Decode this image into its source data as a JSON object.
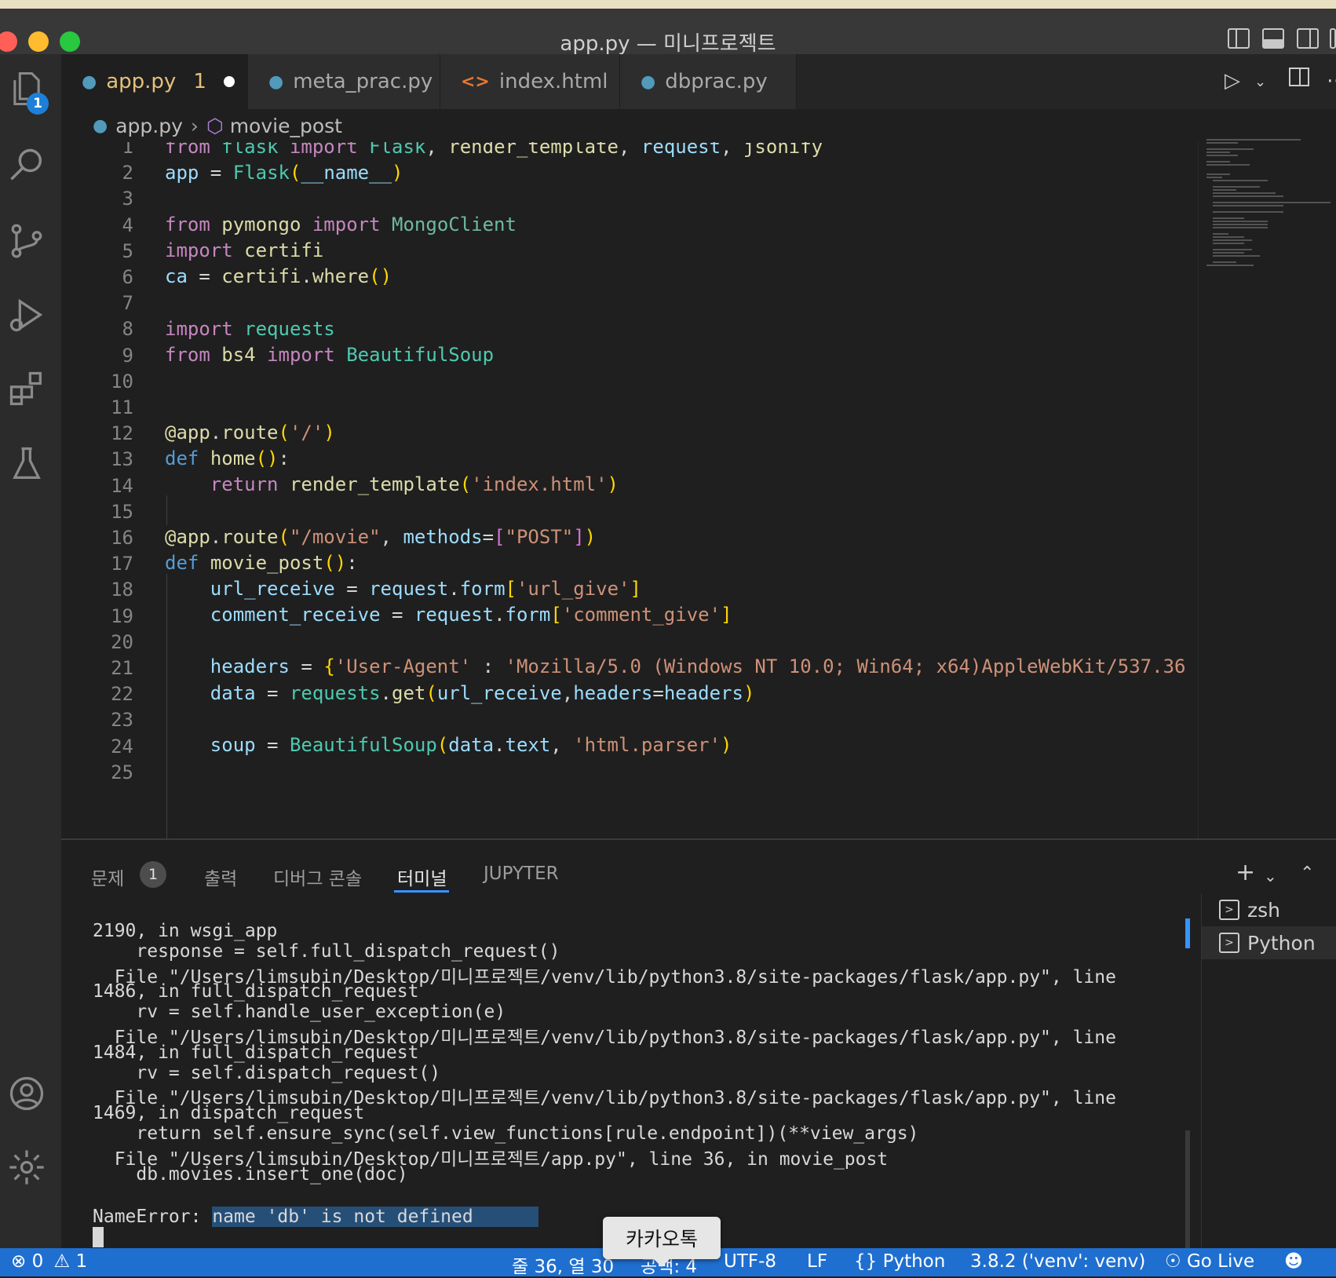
{
  "window": {
    "title": "app.py — 미니프로젝트"
  },
  "activity": {
    "explorer_badge": "1"
  },
  "tabs": [
    {
      "label": "app.py",
      "problems": "1"
    },
    {
      "label": "meta_prac.py"
    },
    {
      "label": "index.html"
    },
    {
      "label": "dbprac.py"
    }
  ],
  "breadcrumb": {
    "file": "app.py",
    "symbol": "movie_post"
  },
  "editor": {
    "line_numbers": [
      "1",
      "2",
      "3",
      "4",
      "5",
      "6",
      "7",
      "8",
      "9",
      "10",
      "11",
      "12",
      "13",
      "14",
      "15",
      "16",
      "17",
      "18",
      "19",
      "20",
      "21",
      "22",
      "23",
      "24",
      "25"
    ]
  },
  "panel": {
    "tabs": {
      "problems": "문제",
      "problems_count": "1",
      "output": "출력",
      "debug_console": "디버그 콘솔",
      "terminal": "터미널",
      "jupyter": "JUPYTER"
    },
    "terminal_lines": [
      "2190, in wsgi_app",
      "    response = self.full_dispatch_request()",
      "  File \"/Users/limsubin/Desktop/미니프로젝트/venv/lib/python3.8/site-packages/flask/app.py\", line",
      "1486, in full_dispatch_request",
      "    rv = self.handle_user_exception(e)",
      "  File \"/Users/limsubin/Desktop/미니프로젝트/venv/lib/python3.8/site-packages/flask/app.py\", line",
      "1484, in full_dispatch_request",
      "    rv = self.dispatch_request()",
      "  File \"/Users/limsubin/Desktop/미니프로젝트/venv/lib/python3.8/site-packages/flask/app.py\", line",
      "1469, in dispatch_request",
      "    return self.ensure_sync(self.view_functions[rule.endpoint])(**view_args)",
      "  File \"/Users/limsubin/Desktop/미니프로젝트/app.py\", line 36, in movie_post",
      "    db.movies.insert_one(doc)"
    ],
    "error_prefix": "NameError: ",
    "error_message": "name 'db' is not defined",
    "terminals": [
      "zsh",
      "Python"
    ]
  },
  "status": {
    "errors": "0",
    "warnings": "1",
    "position": "줄 36, 열 30",
    "spaces": "공백: 4",
    "encoding": "UTF-8",
    "eol": "LF",
    "language": "Python",
    "interpreter": "3.8.2 ('venv': venv)",
    "golive": "Go Live"
  },
  "tooltip": {
    "text": "카카오톡"
  },
  "colors": {
    "accent": "#1f6fd0",
    "active_tab_text": "#e5c07b",
    "selection": "#264f78"
  }
}
